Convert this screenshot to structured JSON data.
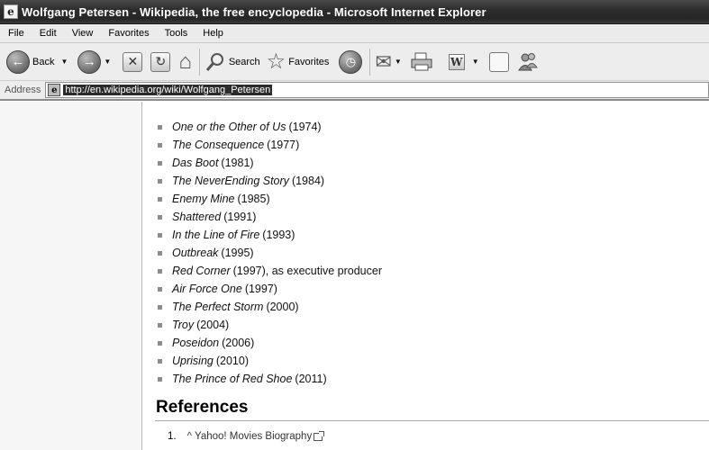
{
  "window": {
    "title": "Wolfgang Petersen - Wikipedia, the free encyclopedia - Microsoft Internet Explorer",
    "icon_glyph": "e"
  },
  "menu": [
    "File",
    "Edit",
    "View",
    "Favorites",
    "Tools",
    "Help"
  ],
  "toolbar": {
    "back_label": "Back",
    "search_label": "Search",
    "favorites_label": "Favorites"
  },
  "address": {
    "label": "Address",
    "url": "http://en.wikipedia.org/wiki/Wolfgang_Petersen"
  },
  "filmography": [
    {
      "title": "One or the Other of Us",
      "suffix": "(1974)"
    },
    {
      "title": "The Consequence",
      "suffix": "(1977)"
    },
    {
      "title": "Das Boot",
      "suffix": "(1981)"
    },
    {
      "title": "The NeverEnding Story",
      "suffix": "(1984)"
    },
    {
      "title": "Enemy Mine",
      "suffix": "(1985)"
    },
    {
      "title": "Shattered",
      "suffix": "(1991)"
    },
    {
      "title": "In the Line of Fire",
      "suffix": "(1993)"
    },
    {
      "title": "Outbreak",
      "suffix": "(1995)"
    },
    {
      "title": "Red Corner",
      "suffix": "(1997), as executive producer"
    },
    {
      "title": "Air Force One",
      "suffix": "(1997)"
    },
    {
      "title": "The Perfect Storm",
      "suffix": "(2000)"
    },
    {
      "title": "Troy",
      "suffix": "(2004)"
    },
    {
      "title": "Poseidon",
      "suffix": "(2006)"
    },
    {
      "title": "Uprising",
      "suffix": "(2010)"
    },
    {
      "title": "The Prince of Red Shoe",
      "suffix": "(2011)"
    }
  ],
  "references": {
    "heading": "References",
    "items": [
      {
        "number": "1.",
        "caret": "^",
        "text": "Yahoo! Movies Biography"
      }
    ]
  }
}
